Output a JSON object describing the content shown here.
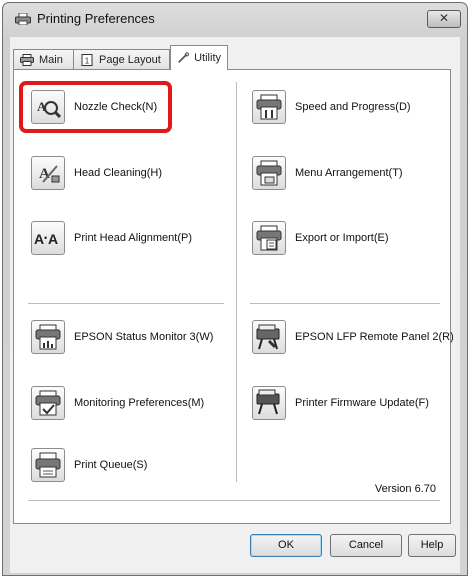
{
  "window": {
    "title": "Printing Preferences",
    "close_label": "✕"
  },
  "tabs": [
    {
      "label": "Main",
      "icon": "printer-icon"
    },
    {
      "label": "Page Layout",
      "icon": "page-layout-icon"
    },
    {
      "label": "Utility",
      "icon": "wrench-icon",
      "selected": true
    }
  ],
  "utilities": {
    "left": [
      {
        "label": "Nozzle Check(N)",
        "icon": "nozzle-check-icon",
        "highlighted": true
      },
      {
        "label": "Head Cleaning(H)",
        "icon": "head-cleaning-icon"
      },
      {
        "label": "Print Head Alignment(P)",
        "icon": "head-alignment-icon"
      },
      {
        "label": "EPSON Status Monitor 3(W)",
        "icon": "status-monitor-icon"
      },
      {
        "label": "Monitoring Preferences(M)",
        "icon": "monitoring-preferences-icon"
      },
      {
        "label": "Print Queue(S)",
        "icon": "print-queue-icon"
      }
    ],
    "right": [
      {
        "label": "Speed and Progress(D)",
        "icon": "speed-progress-icon"
      },
      {
        "label": "Menu Arrangement(T)",
        "icon": "menu-arrangement-icon"
      },
      {
        "label": "Export or Import(E)",
        "icon": "export-import-icon"
      },
      {
        "label": "EPSON LFP Remote Panel 2(R)",
        "icon": "remote-panel-icon"
      },
      {
        "label": "Printer Firmware Update(F)",
        "icon": "firmware-update-icon"
      }
    ]
  },
  "version": "Version 6.70",
  "buttons": {
    "ok": "OK",
    "cancel": "Cancel",
    "help": "Help"
  },
  "colors": {
    "highlight": "#e01a1a"
  }
}
